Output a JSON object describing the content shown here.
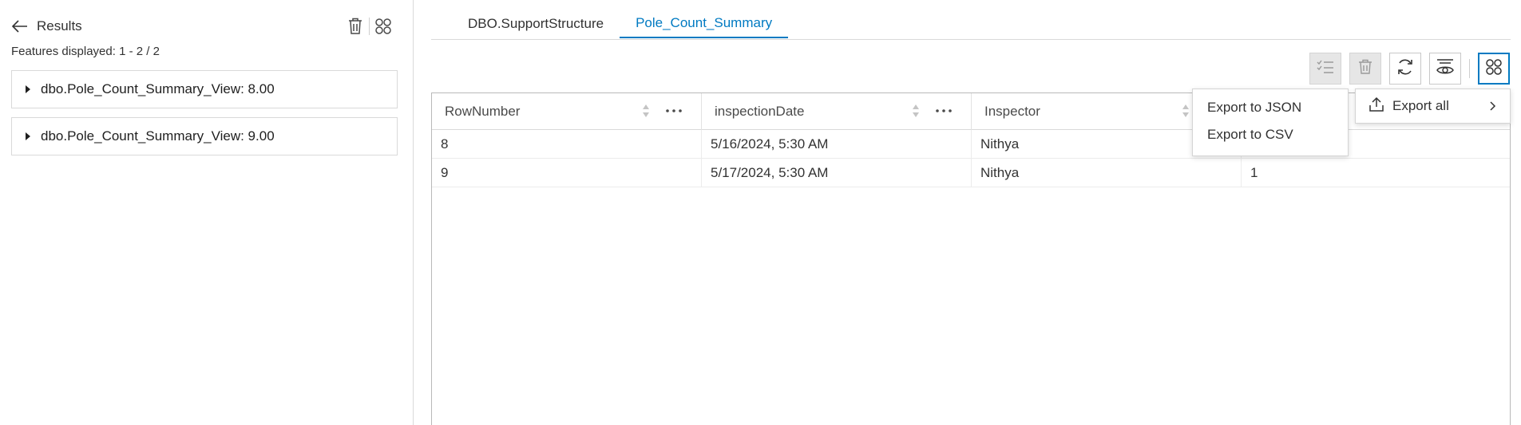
{
  "results_panel": {
    "title": "Results",
    "features_displayed": "Features displayed: 1 - 2 / 2",
    "groups": [
      {
        "label": "dbo.Pole_Count_Summary_View: 8.00"
      },
      {
        "label": "dbo.Pole_Count_Summary_View: 9.00"
      }
    ],
    "icons": {
      "back": "arrow-left-icon",
      "delete": "trash-icon",
      "options": "grid-options-icon",
      "expand": "caret-right-icon"
    }
  },
  "tabs": [
    {
      "label": "DBO.SupportStructure",
      "active": false
    },
    {
      "label": "Pole_Count_Summary",
      "active": true
    }
  ],
  "toolbar": {
    "buttons": [
      {
        "icon": "checklist-icon",
        "state": "disabled"
      },
      {
        "icon": "trash-icon",
        "state": "disabled"
      },
      {
        "icon": "refresh-icon",
        "state": "enabled"
      },
      {
        "icon": "visibility-filter-icon",
        "state": "enabled"
      },
      {
        "icon": "grid-options-icon",
        "state": "active"
      }
    ]
  },
  "table": {
    "columns": [
      "RowNumber",
      "inspectionDate",
      "Inspector",
      ""
    ],
    "rows": [
      [
        "8",
        "5/16/2024, 5:30 AM",
        "Nithya",
        ""
      ],
      [
        "9",
        "5/17/2024, 5:30 AM",
        "Nithya",
        "1"
      ]
    ]
  },
  "export_menu": {
    "items": [
      "Export to JSON",
      "Export to CSV"
    ]
  },
  "export_all": {
    "label": "Export all"
  },
  "colors": {
    "accent": "#007ac2",
    "text": "#323232",
    "border": "#d9d9d9",
    "disabled_bg": "#e6e6e6"
  }
}
